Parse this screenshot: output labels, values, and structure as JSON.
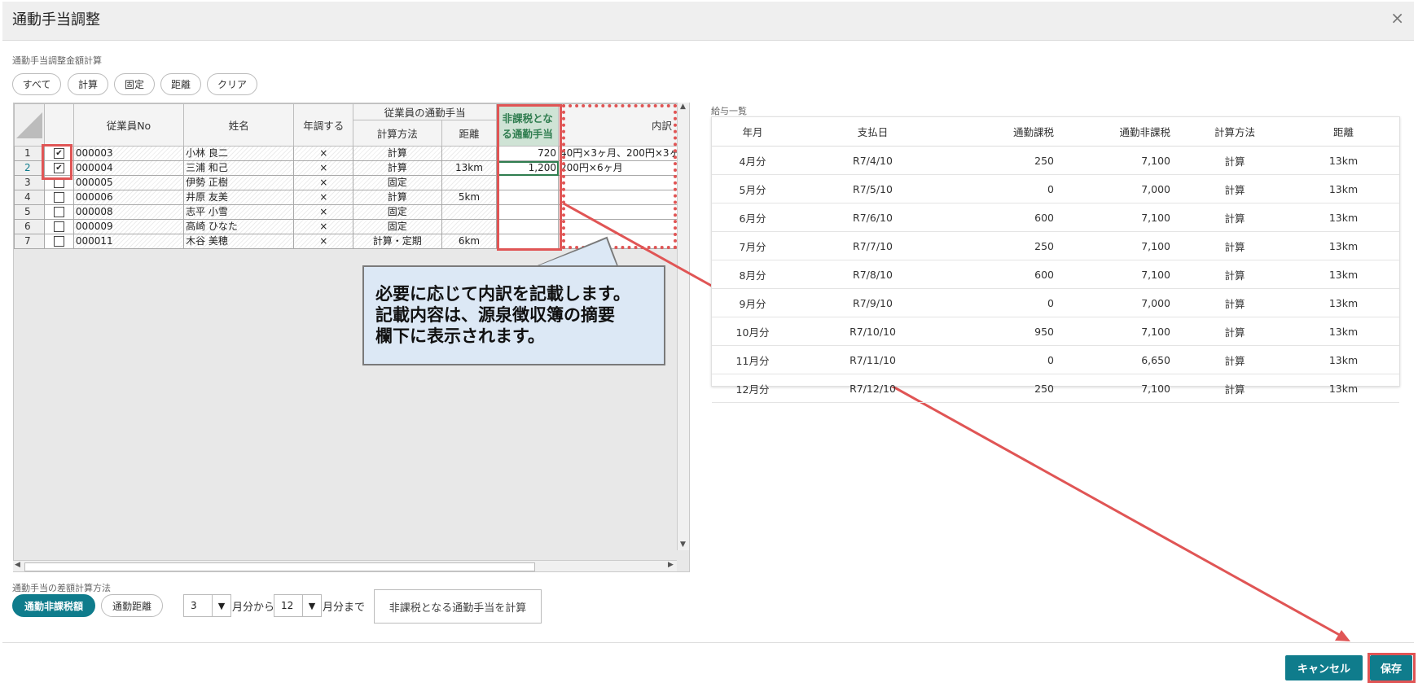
{
  "dialog": {
    "title": "通動手当調整",
    "close_icon": "×"
  },
  "calc": {
    "section_label": "通勤手当調整金額計算",
    "buttons": [
      "すべて",
      "計算",
      "固定",
      "距離",
      "クリア"
    ]
  },
  "grid": {
    "headers": {
      "employee_no": "従業員No",
      "name": "姓名",
      "year_adjust": "年調する",
      "group": "従業員の通勤手当",
      "calc_method": "計算方法",
      "distance": "距離",
      "nontax_line1": "非課税とな",
      "nontax_line2": "る通勤手当",
      "breakdown": "内訳"
    },
    "rows": [
      {
        "n": "1",
        "checked": "✔",
        "no": "000003",
        "name": "小林 良二",
        "adj": "×",
        "method": "計算",
        "dist": "",
        "nontax": "720",
        "breakdown": "40円×3ヶ月、200円×3ヶ"
      },
      {
        "n": "2",
        "checked": "✔",
        "no": "000004",
        "name": "三浦 和己",
        "adj": "×",
        "method": "計算",
        "dist": "13km",
        "nontax": "1,200",
        "breakdown": "200円×6ヶ月"
      },
      {
        "n": "3",
        "checked": "",
        "no": "000005",
        "name": "伊勢 正樹",
        "adj": "×",
        "method": "固定",
        "dist": "",
        "nontax": "",
        "breakdown": ""
      },
      {
        "n": "4",
        "checked": "",
        "no": "000006",
        "name": "井原 友美",
        "adj": "×",
        "method": "計算",
        "dist": "5km",
        "nontax": "",
        "breakdown": ""
      },
      {
        "n": "5",
        "checked": "",
        "no": "000008",
        "name": "志平 小雪",
        "adj": "×",
        "method": "固定",
        "dist": "",
        "nontax": "",
        "breakdown": ""
      },
      {
        "n": "6",
        "checked": "",
        "no": "000009",
        "name": "高崎 ひなた",
        "adj": "×",
        "method": "固定",
        "dist": "",
        "nontax": "",
        "breakdown": ""
      },
      {
        "n": "7",
        "checked": "",
        "no": "000011",
        "name": "木谷 美穂",
        "adj": "×",
        "method": "計算・定期",
        "dist": "6km",
        "nontax": "",
        "breakdown": ""
      }
    ]
  },
  "callout": {
    "line1": "必要に応じて内訳を記載します。",
    "line2": "記載内容は、源泉徴収簿の摘要",
    "line3": "欄下に表示されます。"
  },
  "salary": {
    "label": "給与一覧",
    "headers": [
      "年月",
      "支払日",
      "通勤課税",
      "通勤非課税",
      "計算方法",
      "距離"
    ],
    "rows": [
      [
        "4月分",
        "R7/4/10",
        "250",
        "7,100",
        "計算",
        "13km"
      ],
      [
        "5月分",
        "R7/5/10",
        "0",
        "7,000",
        "計算",
        "13km"
      ],
      [
        "6月分",
        "R7/6/10",
        "600",
        "7,100",
        "計算",
        "13km"
      ],
      [
        "7月分",
        "R7/7/10",
        "250",
        "7,100",
        "計算",
        "13km"
      ],
      [
        "8月分",
        "R7/8/10",
        "600",
        "7,100",
        "計算",
        "13km"
      ],
      [
        "9月分",
        "R7/9/10",
        "0",
        "7,000",
        "計算",
        "13km"
      ],
      [
        "10月分",
        "R7/10/10",
        "950",
        "7,100",
        "計算",
        "13km"
      ],
      [
        "11月分",
        "R7/11/10",
        "0",
        "6,650",
        "計算",
        "13km"
      ],
      [
        "12月分",
        "R7/12/10",
        "250",
        "7,100",
        "計算",
        "13km"
      ]
    ]
  },
  "diff": {
    "section_label": "通勤手当の差額計算方法",
    "mode_buttons": [
      "通勤非課税額",
      "通勤距離"
    ],
    "from_month": "3",
    "from_suffix": "月分から",
    "to_month": "12",
    "to_suffix": "月分まで",
    "calc_button": "非課税となる通勤手当を計算"
  },
  "footer": {
    "cancel": "キャンセル",
    "save": "保存"
  },
  "colors": {
    "accent": "#0f7c8c",
    "highlight": "#e05555",
    "callout_bg": "#dce8f5"
  }
}
